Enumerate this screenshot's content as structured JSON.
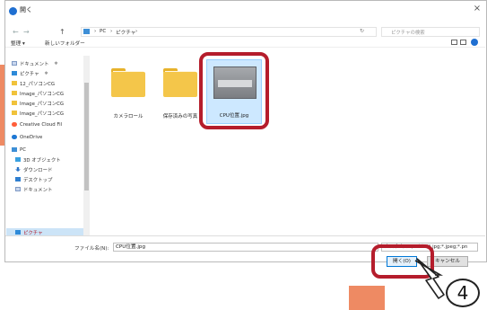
{
  "window": {
    "title": "開く",
    "close_glyph": "×"
  },
  "navigation": {
    "back_glyph": "←",
    "forward_glyph": "→",
    "up_glyph": "↑",
    "breadcrumb": [
      "PC",
      "ピクチャ"
    ],
    "breadcrumb_sep": "›",
    "refresh_glyph": "↻",
    "search_placeholder": "ピクチャの検索"
  },
  "toolbar": {
    "organize_label": "整理 ▾",
    "new_folder_label": "新しいフォルダー"
  },
  "sidebar": {
    "items": [
      {
        "label": "ドキュメント",
        "icon": "document-icon",
        "pinned": true
      },
      {
        "label": "ピクチャ",
        "icon": "pictures-icon",
        "pinned": true
      },
      {
        "label": "12_パソコンCG",
        "icon": "folder-icon"
      },
      {
        "label": "Image_パソコンCG",
        "icon": "folder-icon"
      },
      {
        "label": "Image_パソコンCG",
        "icon": "folder-icon"
      },
      {
        "label": "Image_パソコンCG",
        "icon": "folder-icon"
      },
      {
        "label": "Creative Cloud Fil",
        "icon": "creative-cloud-icon"
      },
      {
        "label": "OneDrive",
        "icon": "onedrive-icon"
      },
      {
        "label": "PC",
        "icon": "pc-icon"
      },
      {
        "label": "3D オブジェクト",
        "icon": "3d-objects-icon"
      },
      {
        "label": "ダウンロード",
        "icon": "download-icon"
      },
      {
        "label": "デスクトップ",
        "icon": "desktop-icon"
      },
      {
        "label": "ドキュメント",
        "icon": "document-icon"
      },
      {
        "label": "ピクチャ",
        "icon": "pictures-icon",
        "selected": true
      }
    ],
    "pin_glyph": "✱"
  },
  "files": [
    {
      "name": "カメラロール",
      "type": "folder"
    },
    {
      "name": "保存済みの写真",
      "type": "folder"
    },
    {
      "name": "CPU位置.jpg",
      "type": "image",
      "selected": true
    }
  ],
  "footer": {
    "filename_label": "ファイル名(N):",
    "filename_value": "CPU位置.jpg",
    "filter_value": "カスタム ファイル (*.jpg;*.jpeg;*.pn",
    "open_label": "開く(O)",
    "cancel_label": "キャンセル"
  },
  "annotation": {
    "step_number": "4"
  },
  "colors": {
    "highlight_red": "#b51d2c",
    "accent_orange": "#ee8a63",
    "selection_blue": "#cde8ff"
  }
}
